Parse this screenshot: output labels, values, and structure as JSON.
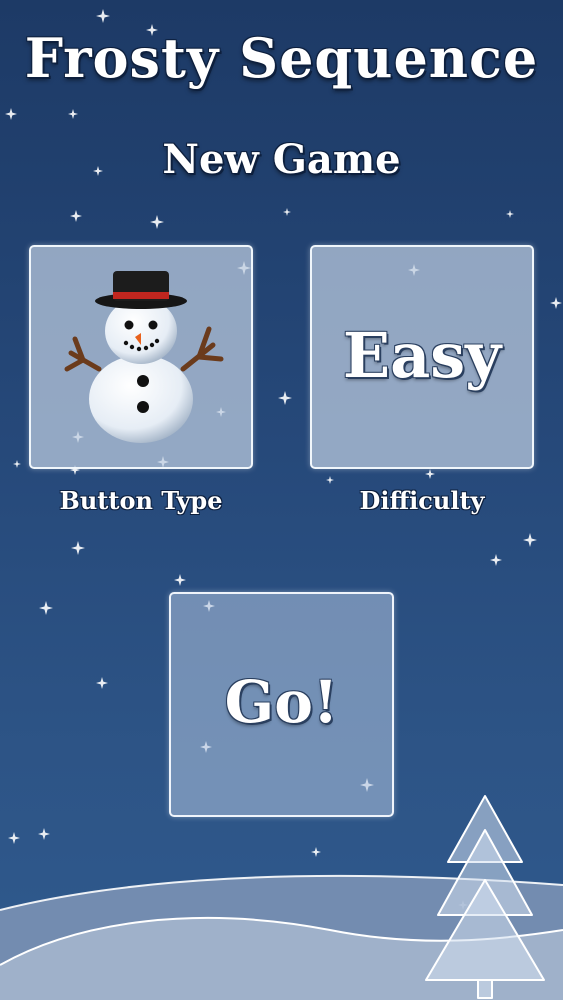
{
  "header": {
    "app_title": "Frosty Sequence",
    "screen_title": "New Game"
  },
  "options": {
    "button_type": {
      "label": "Button Type",
      "selected_icon": "snowman-icon"
    },
    "difficulty": {
      "label": "Difficulty",
      "value": "Easy"
    }
  },
  "actions": {
    "go_label": "Go!"
  },
  "theme": {
    "background_top": "#1d3a66",
    "background_bottom": "#2f5a8e",
    "text": "#ffffff",
    "tile_fill": "#becde1"
  }
}
